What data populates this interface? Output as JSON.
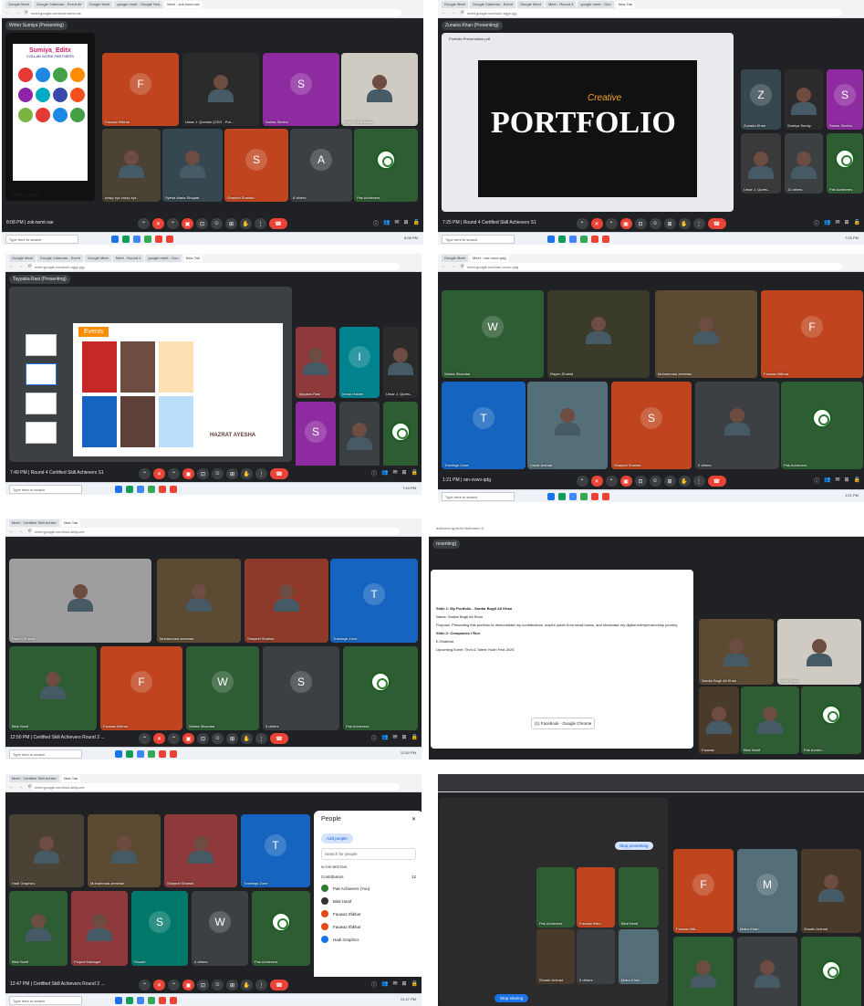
{
  "shots": [
    {
      "id": "s1",
      "url": "meet.google.com/zok-twmt-rae",
      "presenter": "Writer Sumiya (Presenting)",
      "meeting": "8:08 PM | zok-twmt-rae",
      "clock": "8:08 PM",
      "tabs": [
        "Google Meet",
        "Google Calendar - Event de",
        "Google Meet",
        "google meet - Google Sea",
        "Meet - zok-twmt-rae"
      ],
      "tiles": [
        {
          "name": "Fauwaz Iftikhar",
          "initial": "F",
          "color": "#c0451f"
        },
        {
          "name": "Umar J. Qureshi (CEO - Pot...",
          "initial": "",
          "color": "#2b2b2b"
        },
        {
          "name": "Salma Sindhu",
          "initial": "S",
          "color": "#8e2ba0"
        },
        {
          "name": "Engr. Talha Ahsan",
          "initial": "",
          "color": "#cfcac2"
        },
        {
          "name": "crazy xyz crazy xyz",
          "initial": "",
          "color": "#4a4234"
        },
        {
          "name": "Syeda Maria Shujaat",
          "initial": "",
          "color": "#37474f"
        },
        {
          "name": "Sharjeel Shahab",
          "initial": "S",
          "color": "#c0451f"
        },
        {
          "name": "6 others",
          "initial": "A",
          "color": "#3c4043"
        },
        {
          "name": "Pak Achievers",
          "initial": "",
          "color": "#2e5d33"
        }
      ],
      "slide": {
        "title": "Sumiya_Editx",
        "subtitle": "COLLAB WORK PARTNERS",
        "footer": "Writer Sumiya"
      }
    },
    {
      "id": "s2",
      "url": "meet.google.com/ouh-eggr-pjg",
      "presenter": "Zunaira Khan (Presenting)",
      "meeting": "7:25 PM | Round 4 Certified Skill Achievers S1",
      "clock": "7:25 PM",
      "tabs": [
        "Google Meet",
        "Google Calendar - Event",
        "Google Meet",
        "Meet - Round 4",
        "google meet - Goo",
        "New Tab"
      ],
      "tiles": [
        {
          "name": "Zunaira Khan",
          "initial": "Z",
          "color": "#37474f"
        },
        {
          "name": "Sumiya Sumiy..",
          "initial": "",
          "color": "#2b2b2b"
        },
        {
          "name": "Salma Sindhu",
          "initial": "S",
          "color": "#8e2ba0"
        },
        {
          "name": "Umar J. Qures...",
          "initial": "",
          "color": "#3a3a3a"
        },
        {
          "name": "11 others",
          "initial": "",
          "color": "#3c4043"
        },
        {
          "name": "Pak Achievers",
          "initial": "",
          "color": "#2e5d33"
        }
      ],
      "slide": {
        "title": "PORTFOLIO",
        "subtitle": "Creative",
        "file": "Portfolio Presentation.pdf"
      }
    },
    {
      "id": "s3",
      "url": "meet.google.com/ouh-eggr-pjg",
      "presenter": "Tayyaba Rasi (Presenting)",
      "meeting": "7:49 PM | Round 4 Certified Skill Achievers S1",
      "clock": "7:49 PM",
      "tabs": [
        "Google Meet",
        "Google Calendar - Event",
        "Google Meet",
        "Meet - Round 4",
        "google meet - Goo",
        "New Tab"
      ],
      "tiles": [
        {
          "name": "Tayyaba Rasi",
          "initial": "",
          "color": "#8e3a3a"
        },
        {
          "name": "Imran Haider",
          "initial": "I",
          "color": "#00838f"
        },
        {
          "name": "Umar J. Qures...",
          "initial": "",
          "color": "#2b2b2b"
        },
        {
          "name": "Salma Sindhu",
          "initial": "S",
          "color": "#8e2ba0"
        },
        {
          "name": "10 others",
          "initial": "",
          "color": "#3c4043"
        },
        {
          "name": "Pak Achievers",
          "initial": "",
          "color": "#2e5d33"
        }
      ],
      "slide": {
        "title": "Events",
        "subtitle": "HAZRAT AYESHA"
      }
    },
    {
      "id": "s4",
      "url": "meet.google.com/ran-ovwv-qdg",
      "presenter": "",
      "meeting": "1:21 PM | ran-ovwv-qdg",
      "clock": "1:21 PM",
      "tabs": [
        "Google Meet",
        "Meet - ran-ovwv-qdg"
      ],
      "tiles": [
        {
          "name": "Warda Sikandar",
          "initial": "W",
          "color": "#2e5d33"
        },
        {
          "name": "Rayen Shahid",
          "initial": "",
          "color": "#3a3a2a"
        },
        {
          "name": "Muhammad zeeshan",
          "initial": "",
          "color": "#5d4a33"
        },
        {
          "name": "Fauwaz Iftikhar",
          "initial": "F",
          "color": "#c0451f"
        },
        {
          "name": "Trainings Zone",
          "initial": "T",
          "color": "#1565c0"
        },
        {
          "name": "Umair Arshad",
          "initial": "",
          "color": "#546e7a"
        },
        {
          "name": "Sharjeel Shahab",
          "initial": "S",
          "color": "#c0451f"
        },
        {
          "name": "2 others",
          "initial": "",
          "color": "#3c4043"
        },
        {
          "name": "Pak Achievers",
          "initial": "",
          "color": "#2e5d33"
        }
      ]
    },
    {
      "id": "s5",
      "url": "meet.google.com/ssh-stthy-ext",
      "presenter": "",
      "meeting": "12:50 PM | Certified Skill Achievers Round 2 ...",
      "clock": "12:50 PM",
      "tabs": [
        "Meet - Certified Skill Achiev",
        "New Tab"
      ],
      "tiles": [
        {
          "name": "Rayen Shahid",
          "initial": "",
          "color": "#9e9e9e"
        },
        {
          "name": "Muhammad zeeshan",
          "initial": "",
          "color": "#5d4a33"
        },
        {
          "name": "Sharjeel Shahab",
          "initial": "",
          "color": "#8e3a2a"
        },
        {
          "name": "Trainings Zone",
          "initial": "T",
          "color": "#1565c0"
        },
        {
          "name": "Bilal Hanif",
          "initial": "",
          "color": "#2e5d33"
        },
        {
          "name": "Fauwaz Iftikhar",
          "initial": "F",
          "color": "#c0451f"
        },
        {
          "name": "Warda Sikandar",
          "initial": "W",
          "color": "#2e5d33"
        },
        {
          "name": "4 others",
          "initial": "S",
          "color": "#3c4043"
        },
        {
          "name": "Pak Achievers",
          "initial": "",
          "color": "#2e5d33"
        }
      ]
    },
    {
      "id": "s6",
      "url": "auth/wvz-qpnt-ta?authuser=0",
      "presenter": "resenting)",
      "tiles": [
        {
          "name": "Sardar Bugti Ali Khan",
          "initial": "",
          "color": "#5d4a33"
        },
        {
          "name": "Anns Gilani",
          "initial": "",
          "color": "#cfcac2"
        },
        {
          "name": "Fauwaz",
          "initial": "",
          "color": "#4a3a2a"
        },
        {
          "name": "Bilal Hanif",
          "initial": "",
          "color": "#2e5d33"
        },
        {
          "name": "Pak Achiev...",
          "initial": "",
          "color": "#2e5d33"
        }
      ],
      "doc": {
        "h1": "Slide 1: My Portfolio - Sardar Bugti Ali Khan",
        "l1": "Name: Sardar Bugti Ali Khan",
        "l2": "Purpose: Presenting this portfolio to demonstrate my contributions, inspire youth from small towns, and showcase my digital entrepreneurship journey.",
        "h2": "Slide 2: Companies I Run",
        "l3": "E-Shahbar",
        "l4": "Upcoming Event: Tech & Talent Youth Fest 2025",
        "popup": "(1) Facebook - Google Chrome"
      }
    },
    {
      "id": "s7",
      "url": "meet.google.com/ssh-stthy-ext",
      "presenter": "",
      "meeting": "12:47 PM | Certified Skill Achievers Round 2 ...",
      "clock": "12:47 PM",
      "tabs": [
        "Meet - Certified Skill Achiev",
        "New Tab"
      ],
      "tiles": [
        {
          "name": "Hadi Graphics",
          "initial": "",
          "color": "#4a4234"
        },
        {
          "name": "Muhammad zeeshan",
          "initial": "",
          "color": "#5d4a33"
        },
        {
          "name": "Sharjeel Shahab",
          "initial": "",
          "color": "#8e3a3a"
        },
        {
          "name": "Trainings Zone",
          "initial": "T",
          "color": "#1565c0"
        },
        {
          "name": "Bilal Hanif",
          "initial": "",
          "color": "#2e5d33"
        },
        {
          "name": "Project Manager",
          "initial": "",
          "color": "#8e3a3a"
        },
        {
          "name": "Shoaib",
          "initial": "S",
          "color": "#00796b"
        },
        {
          "name": "4 others",
          "initial": "W",
          "color": "#3c4043"
        },
        {
          "name": "Pak Achievers",
          "initial": "",
          "color": "#2e5d33"
        }
      ],
      "people": {
        "title": "People",
        "add": "Add people",
        "search": "Search for people",
        "section": "IN THE MEETING",
        "group": "Contributors",
        "count": "12",
        "list": [
          "Pak Achievers (You)",
          "Bilal Hanif",
          "Fauwaz Iftikhar",
          "Fauwaz Iftikhar",
          "Hadi Graphics"
        ],
        "sub": "Meeting host"
      }
    },
    {
      "id": "s8",
      "presenter": "",
      "stop": "Stop presenting",
      "tiles": [
        {
          "name": "Fauwaz Iftik...",
          "initial": "F",
          "color": "#c0451f"
        },
        {
          "name": "Mairo Khan",
          "initial": "M",
          "color": "#546e7a"
        },
        {
          "name": "Shoaib Arshad",
          "initial": "",
          "color": "#4a3a2a"
        },
        {
          "name": "Bilal Hanif",
          "initial": "",
          "color": "#2e5d33"
        },
        {
          "name": "5 others",
          "initial": "",
          "color": "#3c4043"
        },
        {
          "name": "Pak Achieve...",
          "initial": "",
          "color": "#2e5d33"
        }
      ],
      "small": [
        {
          "name": "Pak Achievers"
        },
        {
          "name": "Fauwaz Iftikh"
        },
        {
          "name": "Bilal Hanif"
        },
        {
          "name": "Shoaib Arshad"
        },
        {
          "name": "5 others"
        },
        {
          "name": "Mairo Khan"
        }
      ],
      "stopbtn": "Stop sharing"
    }
  ],
  "taskbar": {
    "search": "Type here to search"
  },
  "icons": {
    "mic": "mic-off-icon",
    "cam": "camera-icon",
    "end": "end-call-icon"
  }
}
